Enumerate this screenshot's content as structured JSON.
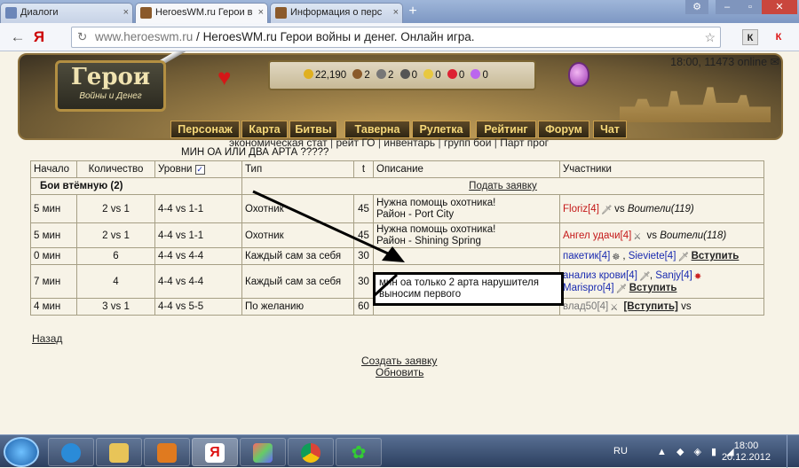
{
  "browser": {
    "tabs": [
      {
        "label": "Диалоги"
      },
      {
        "label": "HeroesWM.ru Герои в"
      },
      {
        "label": "Информация о перс"
      }
    ],
    "address": {
      "host": "www.heroeswm.ru",
      "title": "HeroesWM.ru Герои войны и денег. Онлайн игра."
    },
    "nav": {
      "back": "←",
      "forward": "Я",
      "reload": "C"
    },
    "extensions": [
      {
        "label": "К"
      },
      {
        "label": "К"
      }
    ]
  },
  "header": {
    "logo_title": "Герои",
    "logo_subtitle": "Войны и Денег",
    "resources": [
      "22,190",
      "2",
      "2",
      "0",
      "0",
      "0",
      "0"
    ],
    "clock": "18:00, 11473 online",
    "menu": [
      "Персонаж",
      "Карта",
      "Битвы",
      "Таверна",
      "Рулетка",
      "Рейтинг",
      "Форум",
      "Чат"
    ]
  },
  "sublinks": [
    "экономическая стат",
    "рейт ГО",
    "инвентарь",
    "групп бои",
    "Парт прог"
  ],
  "heading": "МИН ОА ИЛИ ДВА АРТА ?????",
  "table": {
    "headers": [
      "Начало",
      "Количество",
      "Уровни",
      "Тип",
      "t",
      "Описание",
      "Участники"
    ],
    "section_title": "Бои втёмную (2)",
    "apply_link": "Подать заявку",
    "rows": [
      {
        "start": "5 мин",
        "count": "2 vs 1",
        "levels": "4-4 vs 1-1",
        "type": "Охотник",
        "t": "45",
        "desc": [
          "Нужна помощь охотника!",
          "Район - Port City"
        ],
        "participants": [
          {
            "name": "Floriz[4]",
            "color": "red"
          },
          {
            "vs": "vs"
          },
          {
            "name": "Воители(119)",
            "italic": true
          }
        ]
      },
      {
        "start": "5 мин",
        "count": "2 vs 1",
        "levels": "4-4 vs 1-1",
        "type": "Охотник",
        "t": "45",
        "desc": [
          "Нужна помощь охотника!",
          "Район - Shining Spring"
        ],
        "participants": [
          {
            "name": "Ангел удачи[4]",
            "color": "red"
          },
          {
            "vs": "vs"
          },
          {
            "name": "Воители(118)",
            "italic": true
          }
        ]
      },
      {
        "start": "0 мин",
        "count": "6",
        "levels": "4-4 vs 4-4",
        "type": "Каждый сам за себя",
        "t": "30",
        "desc": [],
        "participants": [
          {
            "name": "пакетик[4]",
            "color": "blue"
          },
          {
            "name": "Sieviete[4]",
            "color": "blue"
          },
          {
            "name": "Вступить",
            "join": true
          }
        ]
      },
      {
        "start": "7 мин",
        "count": "4",
        "levels": "4-4 vs 4-4",
        "type": "Каждый сам за себя",
        "t": "30",
        "desc": [
          "мин оа только 2 арта нарушителя",
          "выносим первого"
        ],
        "participants": [
          {
            "name": "анализ крови[4]",
            "color": "blue"
          },
          {
            "name": "Sanjy[4]",
            "color": "blue"
          },
          {
            "name": "Marispro[4]",
            "color": "blue"
          },
          {
            "name": "Вступить",
            "join": true
          }
        ]
      },
      {
        "start": "4 мин",
        "count": "3 vs 1",
        "levels": "4-4 vs 5-5",
        "type": "По желанию",
        "t": "60",
        "desc": [],
        "participants": [
          {
            "name": "влад50[4]",
            "color": "grey"
          },
          {
            "name": "[Вступить]",
            "join": true
          },
          {
            "vs": "vs"
          }
        ]
      }
    ]
  },
  "links": {
    "back": "Назад",
    "create": "Создать заявку",
    "refresh": "Обновить"
  },
  "taskbar": {
    "lang": "RU",
    "time": "18:00",
    "date": "20.12.2012"
  },
  "colors": {
    "menu_text": "#f6d87a",
    "header_gold": "#c9a45b",
    "link_red": "#c41818",
    "link_blue": "#1a2bb0",
    "annotation_border": "#000000"
  }
}
